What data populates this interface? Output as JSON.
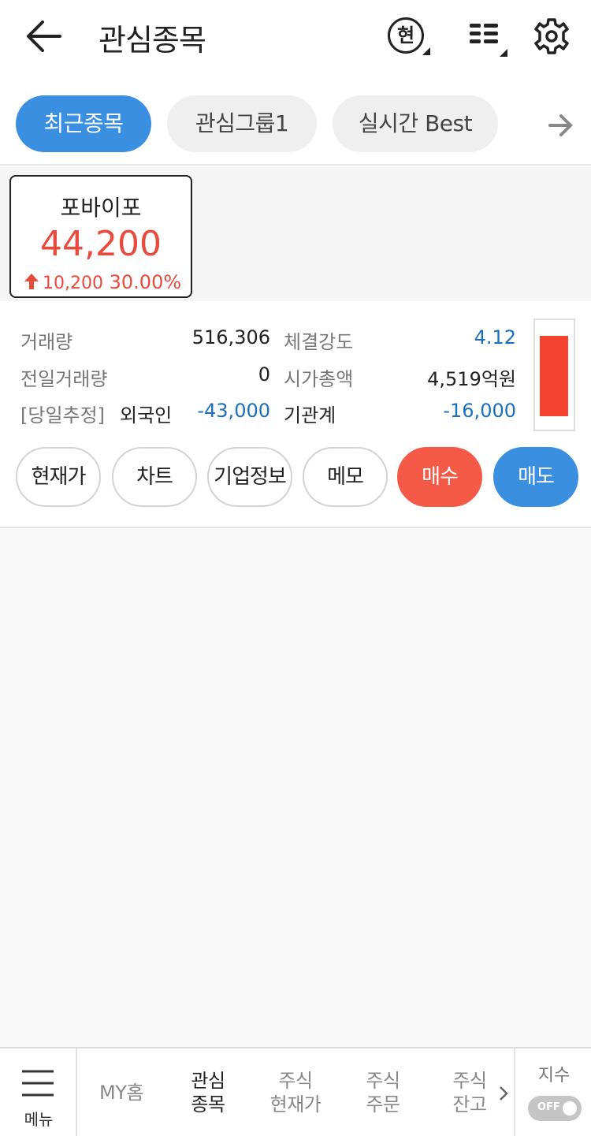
{
  "header": {
    "title": "관심종목",
    "price_type_icon_text": "현",
    "icons": [
      "back-arrow-icon",
      "price-type-icon",
      "list-view-icon",
      "gear-icon"
    ]
  },
  "tabs": [
    {
      "label": "최근종목",
      "active": true
    },
    {
      "label": "관심그룹1",
      "active": false
    },
    {
      "label": "실시간 Best",
      "active": false
    }
  ],
  "stock_card": {
    "name": "포바이포",
    "price": "44,200",
    "change": "10,200",
    "change_pct": "30.00%",
    "direction": "up"
  },
  "details": {
    "volume_label": "거래량",
    "volume_value": "516,306",
    "strength_label": "체결강도",
    "strength_value": "4.12",
    "prev_volume_label": "전일거래량",
    "prev_volume_value": "0",
    "market_cap_label": "시가총액",
    "market_cap_value": "4,519억원",
    "estimate_label": "[당일추정]",
    "foreign_label": "외국인",
    "foreign_value": "-43,000",
    "institution_label": "기관계",
    "institution_value": "-16,000"
  },
  "actions": {
    "current_price": "현재가",
    "chart": "차트",
    "company_info": "기업정보",
    "memo": "메모",
    "buy": "매수",
    "sell": "매도"
  },
  "bottom_nav": {
    "menu_label": "메뉴",
    "items": [
      {
        "line1": "MY홈",
        "line2": "",
        "active": false
      },
      {
        "line1": "관심",
        "line2": "종목",
        "active": true
      },
      {
        "line1": "주식",
        "line2": "현재가",
        "active": false
      },
      {
        "line1": "주식",
        "line2": "주문",
        "active": false
      },
      {
        "line1": "주식",
        "line2": "잔고",
        "active": false
      }
    ],
    "index_label": "지수",
    "index_toggle": "OFF"
  },
  "colors": {
    "accent_blue": "#3a8fe0",
    "up_red": "#e84a3c",
    "down_blue": "#1a6fc0",
    "buy_red": "#f45a47"
  }
}
